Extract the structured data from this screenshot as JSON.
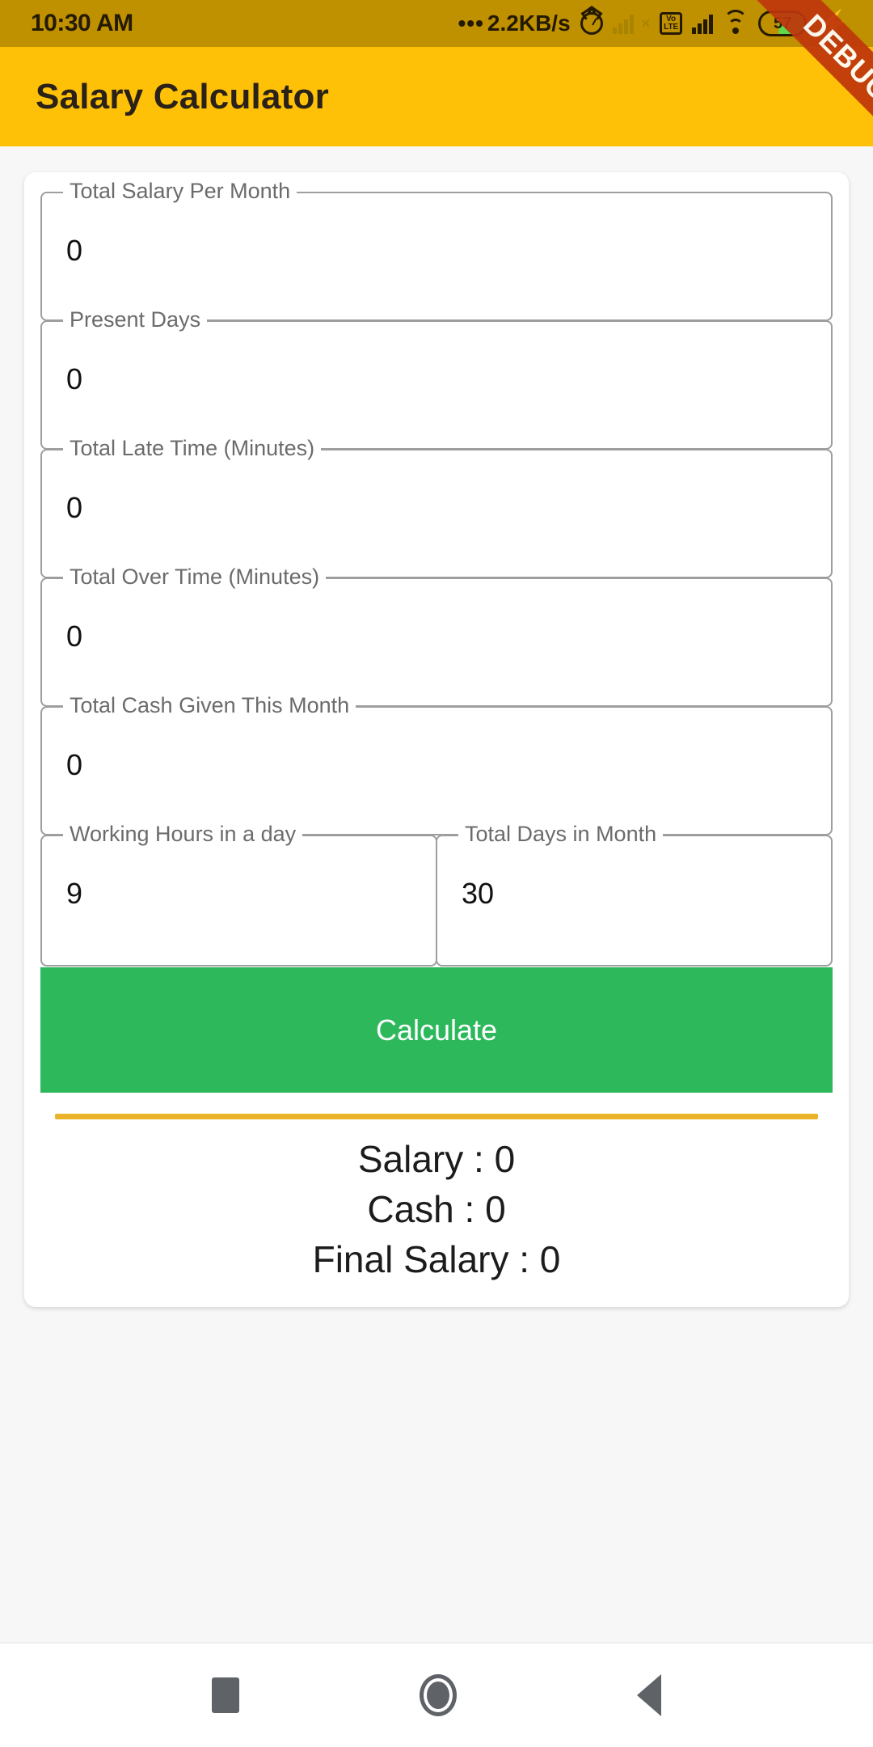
{
  "status_bar": {
    "time": "10:30 AM",
    "network_speed": "2.2KB/s",
    "speed_dots": "•••",
    "volte_top": "Vo",
    "volte_bottom": "LTE",
    "battery_percent": "57",
    "icons": [
      "alarm-icon",
      "signal-no-sim-icon",
      "volte-icon",
      "signal-bars-icon",
      "wifi-icon",
      "battery-icon",
      "charging-bolt-icon"
    ],
    "background_color": "#bf9000"
  },
  "debug_ribbon": {
    "label": "DEBUG",
    "color": "#bf360c"
  },
  "app_bar": {
    "title": "Salary Calculator",
    "background_color": "#ffc107",
    "title_color": "#2a2118"
  },
  "form": {
    "fields": [
      {
        "label": "Total Salary Per Month",
        "value": "0"
      },
      {
        "label": "Present Days",
        "value": "0"
      },
      {
        "label": "Total Late Time (Minutes)",
        "value": "0"
      },
      {
        "label": "Total Over Time (Minutes)",
        "value": "0"
      },
      {
        "label": "Total Cash Given This Month",
        "value": "0"
      }
    ],
    "paired_fields": [
      {
        "label": "Working Hours in a day",
        "value": "9"
      },
      {
        "label": "Total Days in Month",
        "value": "30"
      }
    ],
    "calculate_button": {
      "label": "Calculate",
      "color": "#2eb85c"
    }
  },
  "results": {
    "divider_color": "#eab42a",
    "lines": [
      "Salary : 0",
      "Cash : 0",
      "Final Salary : 0"
    ]
  },
  "nav_bar": {
    "items": [
      "recents-square-icon",
      "home-circle-icon",
      "back-triangle-icon"
    ]
  }
}
